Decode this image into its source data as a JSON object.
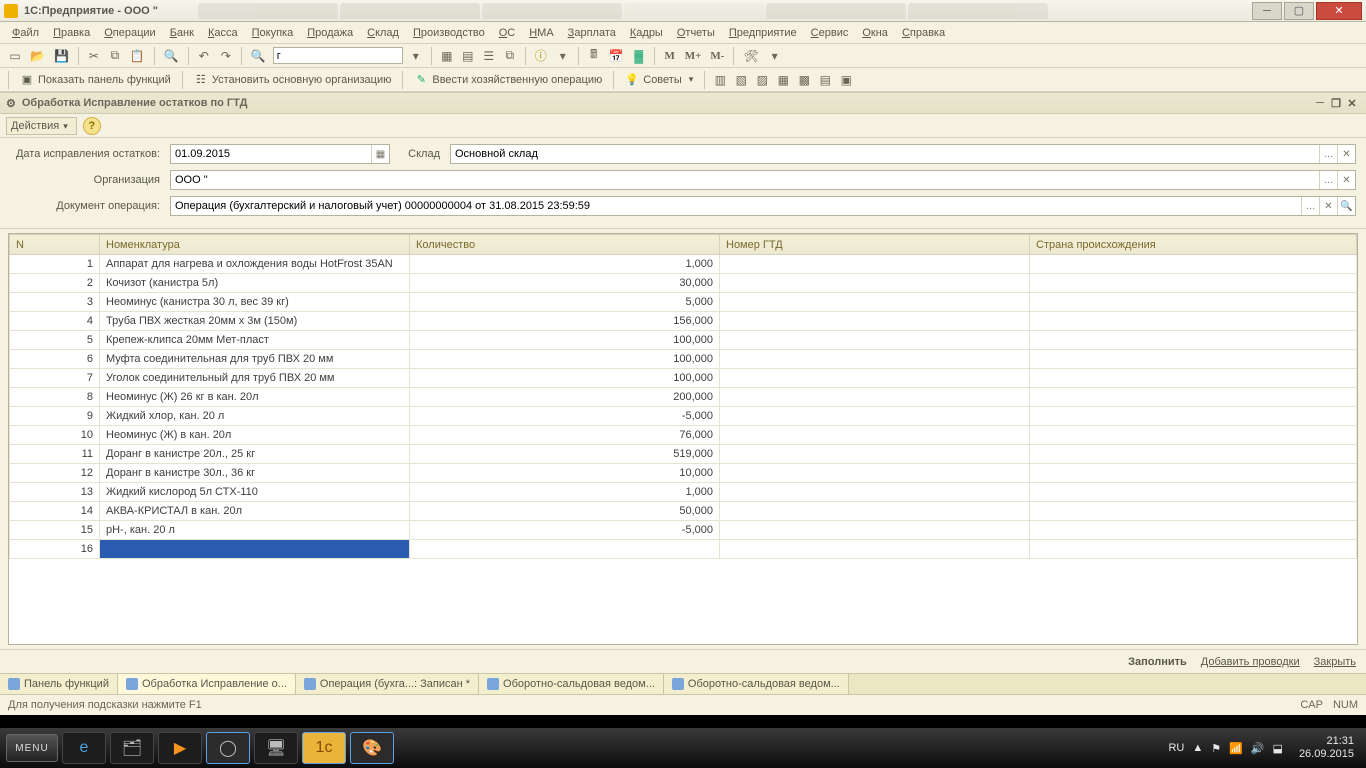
{
  "window": {
    "title": "1С:Предприятие - ООО \""
  },
  "menu": [
    "Файл",
    "Правка",
    "Операции",
    "Банк",
    "Касса",
    "Покупка",
    "Продажа",
    "Склад",
    "Производство",
    "ОС",
    "НМА",
    "Зарплата",
    "Кадры",
    "Отчеты",
    "Предприятие",
    "Сервис",
    "Окна",
    "Справка"
  ],
  "toolbar": {
    "search_value": "г",
    "m_buttons": [
      "М",
      "М+",
      "М-"
    ]
  },
  "toolbar2": {
    "show_panel": "Показать панель функций",
    "set_org": "Установить основную организацию",
    "enter_op": "Ввести хозяйственную операцию",
    "advice": "Советы"
  },
  "doc_header": "Обработка  Исправление остатков по ГТД",
  "actions": {
    "label": "Действия"
  },
  "form": {
    "date_label": "Дата исправления остатков:",
    "date_value": "01.09.2015",
    "wh_label": "Склад",
    "wh_value": "Основной склад",
    "org_label": "Организация",
    "org_value": "ООО \"",
    "doc_label": "Документ операция:",
    "doc_value": "Операция (бухгалтерский и налоговый учет) 00000000004 от 31.08.2015 23:59:59"
  },
  "table": {
    "headers": {
      "n": "N",
      "nom": "Номенклатура",
      "qty": "Количество",
      "gtd": "Номер ГТД",
      "origin": "Страна происхождения"
    },
    "rows": [
      {
        "n": 1,
        "nom": "Аппарат для нагрева и охлождения воды HotFrost 35AN",
        "qty": "1,000"
      },
      {
        "n": 2,
        "nom": "Кочизот (канистра 5л)",
        "qty": "30,000"
      },
      {
        "n": 3,
        "nom": "Неоминус (канистра 30 л, вес 39 кг)",
        "qty": "5,000"
      },
      {
        "n": 4,
        "nom": "Труба ПВХ жесткая 20мм х 3м (150м)",
        "qty": "156,000"
      },
      {
        "n": 5,
        "nom": "Крепеж-клипса 20мм Мет-пласт",
        "qty": "100,000"
      },
      {
        "n": 6,
        "nom": "Муфта соединительная для труб ПВХ 20 мм",
        "qty": "100,000"
      },
      {
        "n": 7,
        "nom": "Уголок соединительный для труб ПВХ 20 мм",
        "qty": "100,000"
      },
      {
        "n": 8,
        "nom": "Неоминус (Ж) 26 кг в кан. 20л",
        "qty": "200,000"
      },
      {
        "n": 9,
        "nom": "Жидкий хлор, кан. 20 л",
        "qty": "-5,000"
      },
      {
        "n": 10,
        "nom": "Неоминус (Ж) в кан. 20л",
        "qty": "76,000"
      },
      {
        "n": 11,
        "nom": "Доранг в канистре 20л., 25 кг",
        "qty": "519,000"
      },
      {
        "n": 12,
        "nom": "Доранг в канистре 30л., 36 кг",
        "qty": "10,000"
      },
      {
        "n": 13,
        "nom": "Жидкий кислород 5л СТХ-110",
        "qty": "1,000"
      },
      {
        "n": 14,
        "nom": "АКВА-КРИСТАЛ в кан. 20л",
        "qty": "50,000"
      },
      {
        "n": 15,
        "nom": "pH-, кан. 20 л",
        "qty": "-5,000"
      },
      {
        "n": 16,
        "nom": "",
        "qty": ""
      }
    ]
  },
  "bottom": {
    "fill": "Заполнить",
    "add": "Добавить проводки",
    "close": "Закрыть"
  },
  "wintabs": [
    "Панель функций",
    "Обработка  Исправление о...",
    "Операция (бухга...: Записан *",
    "Оборотно-сальдовая ведом...",
    "Оборотно-сальдовая ведом..."
  ],
  "status": {
    "hint": "Для получения подсказки нажмите F1",
    "cap": "CAP",
    "num": "NUM"
  },
  "tray": {
    "lang": "RU",
    "time": "21:31",
    "date": "26.09.2015"
  }
}
